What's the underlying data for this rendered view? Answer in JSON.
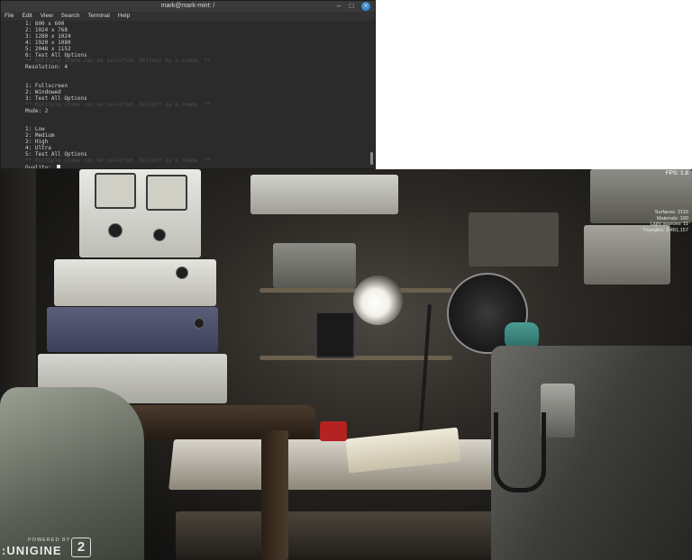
{
  "terminal": {
    "title": "mark@mark-mint: /",
    "controls": {
      "minimize": "–",
      "maximize": "□",
      "close": "✕"
    },
    "menu": [
      "File",
      "Edit",
      "View",
      "Search",
      "Terminal",
      "Help"
    ],
    "lines": [
      {
        "text": "1: 800 x 600",
        "style": "normal"
      },
      {
        "text": "2: 1024 x 768",
        "style": "normal"
      },
      {
        "text": "3: 1280 x 1024",
        "style": "normal"
      },
      {
        "text": "4: 1920 x 1080",
        "style": "normal"
      },
      {
        "text": "5: 2048 x 1152",
        "style": "normal"
      },
      {
        "text": "6: Test All Options",
        "style": "normal"
      },
      {
        "text": "** Multiple items can be selected. Delimit by a comma. **",
        "style": "comment"
      },
      {
        "text": "Resolution: 4",
        "style": "normal"
      },
      {
        "text": "",
        "style": "blank"
      },
      {
        "text": "",
        "style": "blank"
      },
      {
        "text": "1: Fullscreen",
        "style": "normal"
      },
      {
        "text": "2: Windowed",
        "style": "normal"
      },
      {
        "text": "3: Test All Options",
        "style": "normal"
      },
      {
        "text": "** Multiple items can be selected. Delimit by a comma. **",
        "style": "comment"
      },
      {
        "text": "Mode: 2",
        "style": "normal"
      },
      {
        "text": "",
        "style": "blank"
      },
      {
        "text": "",
        "style": "blank"
      },
      {
        "text": "1: Low",
        "style": "normal"
      },
      {
        "text": "2: Medium",
        "style": "normal"
      },
      {
        "text": "3: High",
        "style": "normal"
      },
      {
        "text": "4: Ultra",
        "style": "normal"
      },
      {
        "text": "5: Test All Options",
        "style": "normal"
      },
      {
        "text": "** Multiple items can be selected. Delimit by a comma. **",
        "style": "comment"
      }
    ],
    "prompt": "Quality: "
  },
  "scene": {
    "fps": "FPS: 1.8",
    "stats": [
      "Surfaces: 2115",
      "Materials: 190",
      "Light sources: 11",
      "Triangles: 3,451,157"
    ],
    "logo": {
      "powered": "POWERED BY",
      "name": "UNIGINE",
      "version": "2"
    }
  }
}
